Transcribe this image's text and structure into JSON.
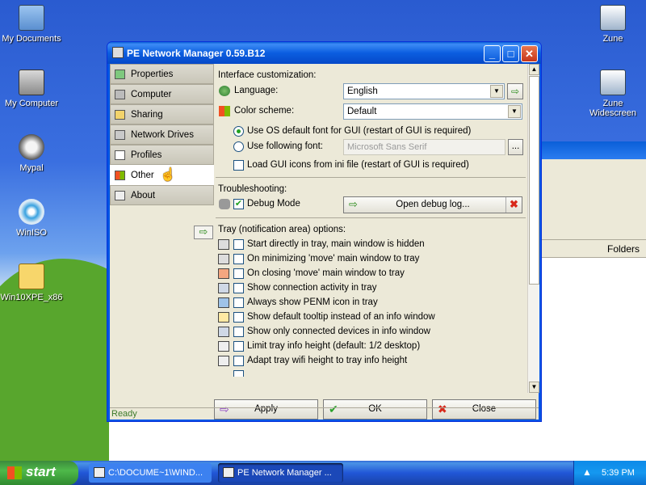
{
  "desktop": {
    "icons": [
      {
        "label": "My Documents"
      },
      {
        "label": "My Computer"
      },
      {
        "label": "Mypal"
      },
      {
        "label": "WinISO"
      },
      {
        "label": "Win10XPE_x86"
      },
      {
        "label": "Zune"
      },
      {
        "label": "Zune Widescreen"
      }
    ],
    "bg_window": {
      "folders_label": "Folders"
    }
  },
  "window": {
    "title": "PE Network Manager 0.59.B12",
    "controls": {
      "minimize": "_",
      "maximize": "□",
      "close": "✕"
    }
  },
  "sidebar": {
    "items": [
      {
        "label": "Properties",
        "icon": "properties-icon"
      },
      {
        "label": "Computer",
        "icon": "computer-icon"
      },
      {
        "label": "Sharing",
        "icon": "sharing-icon"
      },
      {
        "label": "Network Drives",
        "icon": "network-drives-icon"
      },
      {
        "label": "Profiles",
        "icon": "profiles-icon"
      },
      {
        "label": "Other",
        "icon": "other-icon",
        "active": true
      },
      {
        "label": "About",
        "icon": "about-icon"
      }
    ],
    "arrow": "⇨"
  },
  "interface": {
    "header": "Interface customization:",
    "language_label": "Language:",
    "language_value": "English",
    "color_label": "Color scheme:",
    "color_value": "Default",
    "radio_os_font": "Use OS default font for GUI (restart of GUI is required)",
    "radio_following_font": "Use following font:",
    "font_value": "Microsoft Sans Serif",
    "font_browse": "...",
    "load_icons": "Load GUI icons from ini file (restart of GUI is required)"
  },
  "troubleshooting": {
    "header": "Troubleshooting:",
    "debug_label": "Debug Mode",
    "debug_checked": true,
    "open_log": "Open debug log..."
  },
  "tray": {
    "header": "Tray (notification area) options:",
    "options": [
      {
        "label": "Start directly in tray, main window is hidden"
      },
      {
        "label": "On minimizing 'move' main window to tray"
      },
      {
        "label": "On closing 'move' main window to tray"
      },
      {
        "label": "Show connection activity in tray"
      },
      {
        "label": "Always show PENM icon in tray"
      },
      {
        "label": "Show default tooltip instead of an info window"
      },
      {
        "label": "Show only connected devices in info window"
      },
      {
        "label": "Limit tray info height (default: 1/2 desktop)"
      },
      {
        "label": "Adapt tray wifi height to tray info height"
      }
    ]
  },
  "buttons": {
    "apply": "Apply",
    "ok": "OK",
    "close": "Close"
  },
  "status": "Ready",
  "taskbar": {
    "start": "start",
    "tasks": [
      {
        "label": "C:\\DOCUME~1\\WIND..."
      },
      {
        "label": "PE Network Manager ..."
      }
    ],
    "clock": "5:39 PM"
  },
  "colors": {
    "accent": "#0055e5",
    "check_green": "#21a121",
    "close_red": "#d8281a"
  }
}
